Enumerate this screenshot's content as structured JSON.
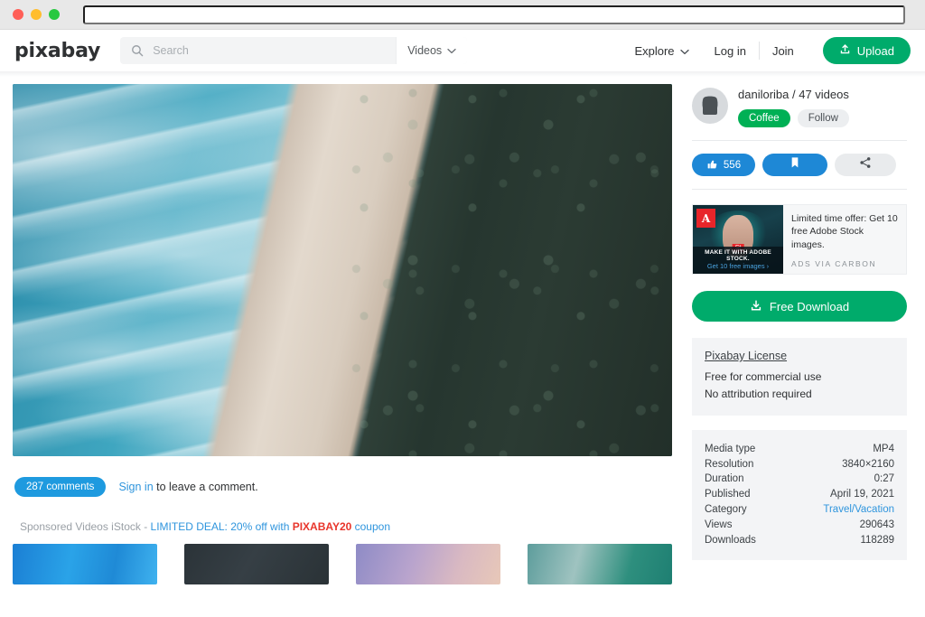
{
  "browser": {
    "url_value": "",
    "url_placeholder": ""
  },
  "header": {
    "logo": "pixabay",
    "search": {
      "placeholder": "Search",
      "value": "",
      "type_label": "Videos",
      "icon": "search-icon",
      "chevron": "chevron-down-icon"
    },
    "nav": {
      "explore": "Explore",
      "login": "Log in",
      "join": "Join",
      "upload": "Upload",
      "upload_icon": "upload-icon"
    }
  },
  "video": {
    "alt": "aerial view of ocean surf, sandy beach and forest"
  },
  "comments": {
    "badge": "287 comments",
    "signin": "Sign in",
    "hint": " to leave a comment."
  },
  "sponsored": {
    "prefix": "Sponsored Videos iStock - ",
    "deal": "LIMITED DEAL: 20% off with ",
    "code": "PIXABAY20",
    "suffix": " coupon"
  },
  "thumbnails": [
    {
      "name": "thumbnail-blue-water"
    },
    {
      "name": "thumbnail-dark-clouds"
    },
    {
      "name": "thumbnail-purple-sunset"
    },
    {
      "name": "thumbnail-teal-wave"
    }
  ],
  "uploader": {
    "name": "daniloriba / 47 videos",
    "coffee": "Coffee",
    "follow": "Follow"
  },
  "actions": {
    "like_count": "556",
    "like_icon": "thumbs-up-icon",
    "save_icon": "bookmark-icon",
    "share_icon": "share-icon"
  },
  "ad": {
    "logo": "A",
    "brand": "Adobe",
    "stock_tag": "St",
    "caption_1": "MAKE IT WITH ADOBE STOCK.",
    "caption_2": "Get 10 free images ›",
    "text": "Limited time offer: Get 10 free Adobe Stock images.",
    "via": "ADS VIA CARBON"
  },
  "download": {
    "label": "Free Download",
    "icon": "download-icon"
  },
  "license": {
    "title": "Pixabay License",
    "line_1": "Free for commercial use",
    "line_2": "No attribution required"
  },
  "meta": {
    "rows": [
      {
        "label": "Media type",
        "value": "MP4",
        "link": false
      },
      {
        "label": "Resolution",
        "value": "3840×2160",
        "link": false
      },
      {
        "label": "Duration",
        "value": "0:27",
        "link": false
      },
      {
        "label": "Published",
        "value": "April 19, 2021",
        "link": false
      },
      {
        "label": "Category",
        "value": "Travel/Vacation",
        "link": true
      },
      {
        "label": "Views",
        "value": "290643",
        "link": false
      },
      {
        "label": "Downloads",
        "value": "118289",
        "link": false
      }
    ]
  },
  "colors": {
    "brand_green": "#00ab6b",
    "action_blue": "#1e88d6",
    "link_blue": "#2f95dd",
    "coffee_green": "#00b055",
    "deal_red": "#e8352b",
    "panel_gray": "#f3f4f6"
  }
}
